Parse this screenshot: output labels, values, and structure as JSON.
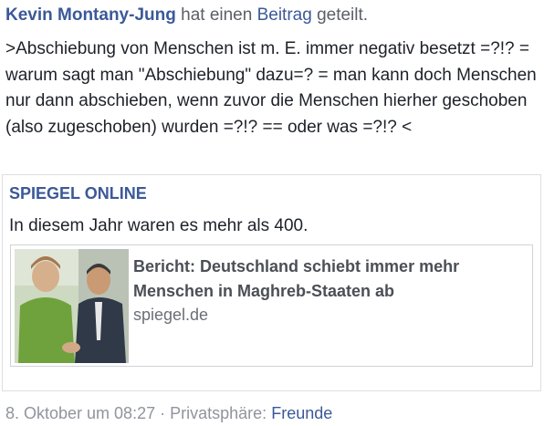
{
  "post": {
    "author": "Kevin Montany-Jung",
    "action_before": "hat einen",
    "action_link": "Beitrag",
    "action_after": "geteilt.",
    "text": ">Abschiebung von Menschen ist m. E. immer negativ besetzt =?!? = warum sagt man \"Abschiebung\" dazu=? = man kann doch Menschen nur dann abschieben, wenn zuvor die Menschen hierher geschoben (also zugeschoben) wurden =?!? == oder was =?!? <"
  },
  "shared": {
    "source": "SPIEGEL ONLINE",
    "description": "In diesem Jahr waren es mehr als 400.",
    "link": {
      "title": "Bericht: Deutschland schiebt immer mehr Menschen in Maghreb-Staaten ab",
      "domain": "spiegel.de",
      "thumbnail_icon": "news-photo-thumbnail"
    }
  },
  "footer": {
    "date": "8. Oktober um 08:27",
    "separator": "·",
    "privacy_label": "Privatsphäre:",
    "audience": "Freunde"
  },
  "colors": {
    "link": "#3b5998",
    "text": "#1d2129",
    "meta": "#90949c",
    "border": "#dddfe2"
  }
}
